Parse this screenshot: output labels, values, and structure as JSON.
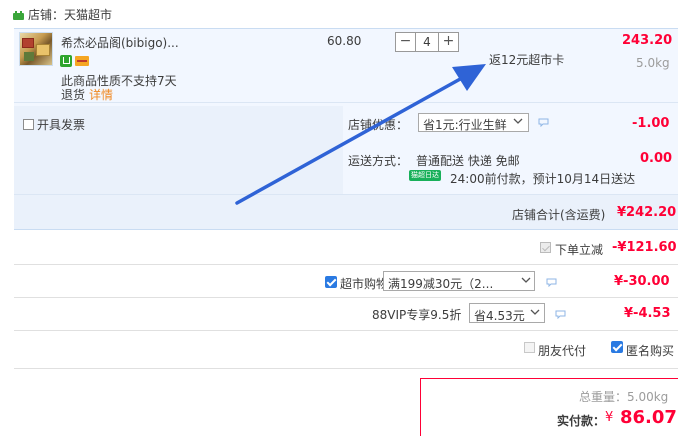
{
  "shop": {
    "label": "店铺：天猫超市"
  },
  "item": {
    "title": "希杰必品阁(bibigo)...",
    "note1": "此商品性质不支持7天",
    "note2": "退货",
    "note2_link": "详情",
    "unit_price": "60.80",
    "qty_minus": "−",
    "qty_value": "4",
    "qty_plus": "+",
    "cashback": "返12元超市卡",
    "subtotal": "243.20",
    "weight": "5.0kg"
  },
  "options": {
    "invoice_label": "开具发票",
    "discount_label": "店铺优惠：",
    "discount_selected": "省1元:行业生鲜",
    "discount_amount": "-1.00",
    "shipping_label": "运送方式：",
    "shipping_method": "普通配送 快递 免邮",
    "shipping_amount": "0.00",
    "tmall_badge": "猫超日达",
    "shipping_note": "24:00前付款，预计10月14日送达",
    "shop_total_label": "店铺合计(含运费)",
    "shop_total_amount": "¥242.20"
  },
  "discounts": {
    "instant_label": "下单立减",
    "instant_amount": "-¥121.60",
    "coupon_label": "超市购物券",
    "coupon_selected": "满199减30元（2...",
    "coupon_amount": "¥-30.00",
    "vip_label": "88VIP专享9.5折",
    "vip_selected": "省4.53元",
    "vip_amount": "¥-4.53",
    "friend_pay_label": "朋友代付",
    "anonymous_label": "匿名购买"
  },
  "summary": {
    "weight_total": "总重量：5.00kg",
    "pay_label": "实付款：",
    "pay_currency": "¥",
    "pay_amount": "86.07"
  },
  "colors": {
    "price_red": "#ff0036",
    "panel_blue": "#f2f7ff",
    "arrow_blue": "#2f63d6"
  }
}
